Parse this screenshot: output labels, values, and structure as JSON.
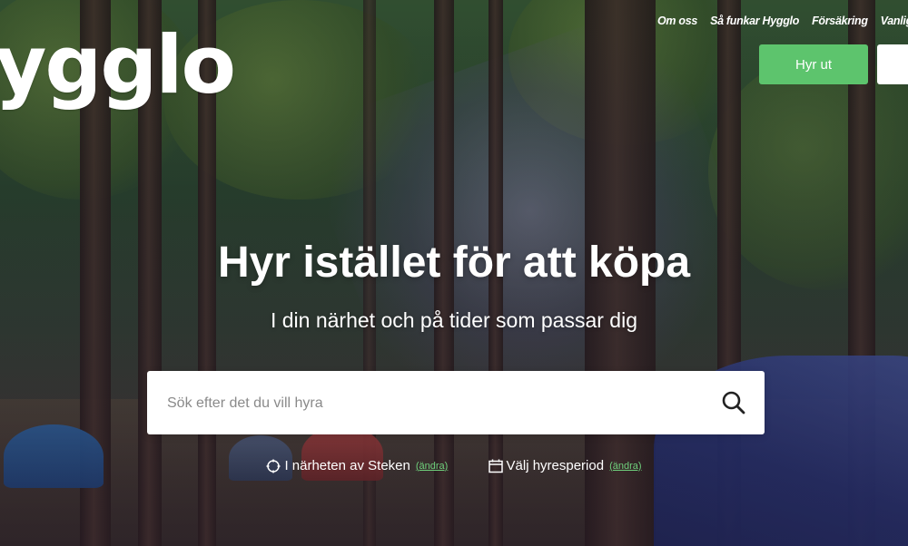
{
  "brand": {
    "logo_text": "ygglo"
  },
  "nav": {
    "links": [
      "Om oss",
      "Så funkar Hygglo",
      "Försäkring",
      "Vanliga frågor"
    ],
    "rent_out_label": "Hyr ut"
  },
  "hero": {
    "title": "Hyr istället för att köpa",
    "subtitle": "I din närhet och på tider som passar dig"
  },
  "search": {
    "placeholder": "Sök efter det du vill hyra",
    "icon": "search-icon"
  },
  "filters": {
    "location_prefix": "I närheten av",
    "location_value": "Steken",
    "location_change": "(ändra)",
    "period_label": "Välj hyresperiod",
    "period_change": "(ändra)"
  },
  "colors": {
    "accent_green": "#5dc46d",
    "link_green": "#6fd07c"
  }
}
